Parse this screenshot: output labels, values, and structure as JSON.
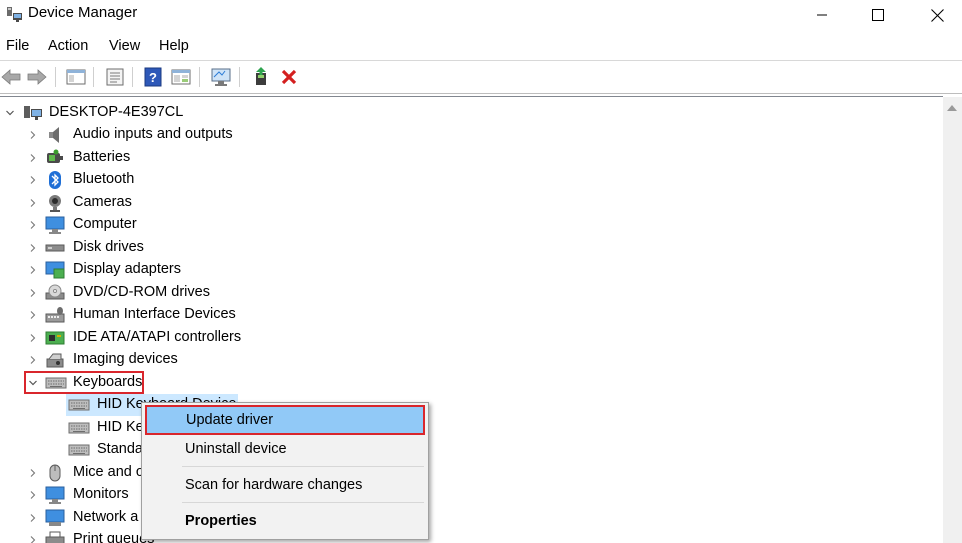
{
  "window": {
    "title": "Device Manager"
  },
  "menu": [
    "File",
    "Action",
    "View",
    "Help"
  ],
  "toolbar": {
    "buttons": [
      "back-icon",
      "forward-icon",
      "show-hide-console-tree-icon",
      "properties-icon",
      "help-icon",
      "view-icon",
      "monitor-icon",
      "enable-device-icon",
      "uninstall-icon"
    ]
  },
  "tree": {
    "root": "DESKTOP-4E397CL",
    "categories": [
      {
        "label": "Audio inputs and outputs",
        "icon": "speaker-icon"
      },
      {
        "label": "Batteries",
        "icon": "battery-icon"
      },
      {
        "label": "Bluetooth",
        "icon": "bluetooth-icon"
      },
      {
        "label": "Cameras",
        "icon": "camera-icon"
      },
      {
        "label": "Computer",
        "icon": "computer-icon"
      },
      {
        "label": "Disk drives",
        "icon": "disk-drive-icon"
      },
      {
        "label": "Display adapters",
        "icon": "display-adapter-icon"
      },
      {
        "label": "DVD/CD-ROM drives",
        "icon": "dvd-drive-icon"
      },
      {
        "label": "Human Interface Devices",
        "icon": "hid-icon"
      },
      {
        "label": "IDE ATA/ATAPI controllers",
        "icon": "ide-controller-icon"
      },
      {
        "label": "Imaging devices",
        "icon": "imaging-device-icon"
      },
      {
        "label": "Keyboards",
        "icon": "keyboard-icon"
      }
    ],
    "keyboard_children": [
      "HID Keyboard Device",
      "HID Ke",
      "Standa"
    ],
    "more_categories": [
      {
        "label": "Mice and o",
        "icon": "mouse-icon"
      },
      {
        "label": "Monitors",
        "icon": "monitor-icon"
      },
      {
        "label": "Network a",
        "icon": "network-icon"
      },
      {
        "label": "Print queues",
        "icon": "printer-icon"
      }
    ]
  },
  "context_menu": {
    "update": "Update driver",
    "uninstall": "Uninstall device",
    "scan": "Scan for hardware changes",
    "properties": "Properties"
  },
  "colors": {
    "highlight_red": "#d9262c",
    "selection_blue": "#cce8ff",
    "menu_hover": "#91c9f7"
  }
}
